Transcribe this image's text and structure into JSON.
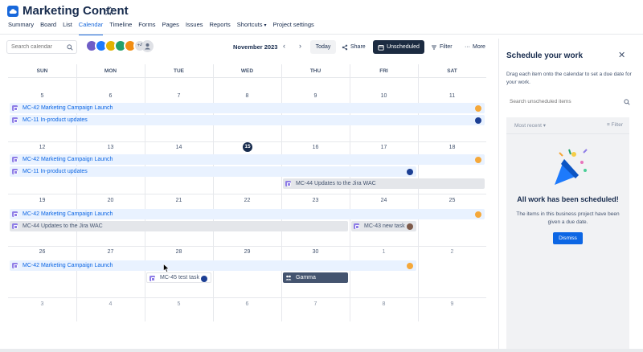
{
  "app": {
    "title": "Marketing Content",
    "tabs": [
      "Summary",
      "Board",
      "List",
      "Calendar",
      "Timeline",
      "Forms",
      "Pages",
      "Issues",
      "Reports",
      "Shortcuts",
      "Project settings"
    ],
    "active_tab": "Calendar"
  },
  "toolbar": {
    "search_placeholder": "Search calendar",
    "avatar_more": "+4",
    "month": "November 2023",
    "today": "Today",
    "share": "Share",
    "unscheduled": "Unscheduled",
    "filter": "Filter",
    "more": "More"
  },
  "calendar": {
    "weekdays": [
      "SUN",
      "MON",
      "TUE",
      "WED",
      "THU",
      "FRI",
      "SAT"
    ],
    "weeks": [
      [
        "5",
        "6",
        "7",
        "8",
        "9",
        "10",
        "11"
      ],
      [
        "12",
        "13",
        "14",
        "15",
        "16",
        "17",
        "18"
      ],
      [
        "19",
        "20",
        "21",
        "22",
        "23",
        "24",
        "25"
      ],
      [
        "26",
        "27",
        "28",
        "29",
        "30",
        "1",
        "2"
      ],
      [
        "3",
        "4",
        "5",
        "6",
        "7",
        "8",
        "9"
      ]
    ],
    "today": "15",
    "events": {
      "campaign": "MC-42 Marketing Campaign Launch",
      "inproduct": "MC-11 In-product updates",
      "jira_wac": "MC-44 Updates to the Jira WAC",
      "new_task": "MC-43 new task",
      "test_task": "MC-45 test task",
      "gamma": "Gamma"
    }
  },
  "panel": {
    "title": "Schedule your work",
    "description": "Drag each item onto the calendar to set a due date for your work.",
    "search_placeholder": "Search unscheduled items",
    "sort": "Most recent",
    "filter": "Filter",
    "empty_title": "All work has been scheduled!",
    "empty_desc": "The items in this business project have been given a due date.",
    "dismiss": "Dismiss"
  },
  "colors": {
    "accent": "#1868db",
    "event_blue_bg": "#e9f2ff",
    "event_gray_bg": "#e4e6ea",
    "dark_button": "#1c2b41",
    "epic_purple": "#8f7ee7"
  }
}
